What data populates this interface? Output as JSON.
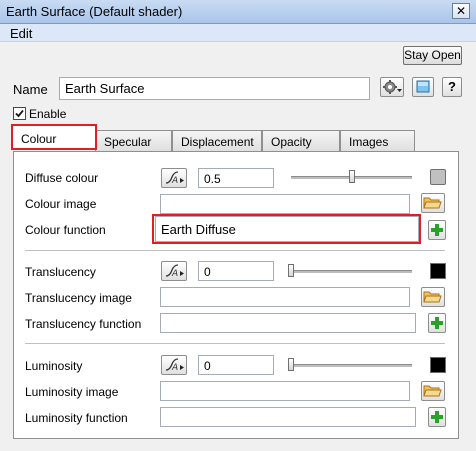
{
  "window": {
    "title": "Earth Surface     (Default shader)",
    "close_label": "✕"
  },
  "menu": {
    "items": [
      "Edit"
    ]
  },
  "toolbar": {
    "stay_open": "Stay Open"
  },
  "name_row": {
    "label": "Name",
    "value": "Earth Surface",
    "help": "?"
  },
  "enable": {
    "label": "Enable",
    "checked": true
  },
  "tabs": [
    "Colour",
    "Specular",
    "Displacement",
    "Opacity",
    "Images"
  ],
  "active_tab": "Colour",
  "sections": {
    "colour": {
      "value_label": "Diffuse colour",
      "value": "0.5",
      "slider_fraction": 0.5,
      "swatch": "#c0c0c0",
      "image_label": "Colour image",
      "image_value": "",
      "function_label": "Colour function",
      "function_value": "Earth Diffuse"
    },
    "translucency": {
      "value_label": "Translucency",
      "value": "0",
      "slider_fraction": 0,
      "swatch": "#000000",
      "image_label": "Translucency image",
      "image_value": "",
      "function_label": "Translucency function",
      "function_value": ""
    },
    "luminosity": {
      "value_label": "Luminosity",
      "value": "0",
      "slider_fraction": 0,
      "swatch": "#000000",
      "image_label": "Luminosity image",
      "image_value": "",
      "function_label": "Luminosity function",
      "function_value": ""
    }
  },
  "colors": {
    "highlight": "#e02020",
    "folder": "#e8b44a",
    "add": "#2aa12a"
  },
  "icons": [
    "gear-icon",
    "preview-icon",
    "help-icon",
    "curve-icon",
    "folder-icon",
    "add-icon"
  ]
}
